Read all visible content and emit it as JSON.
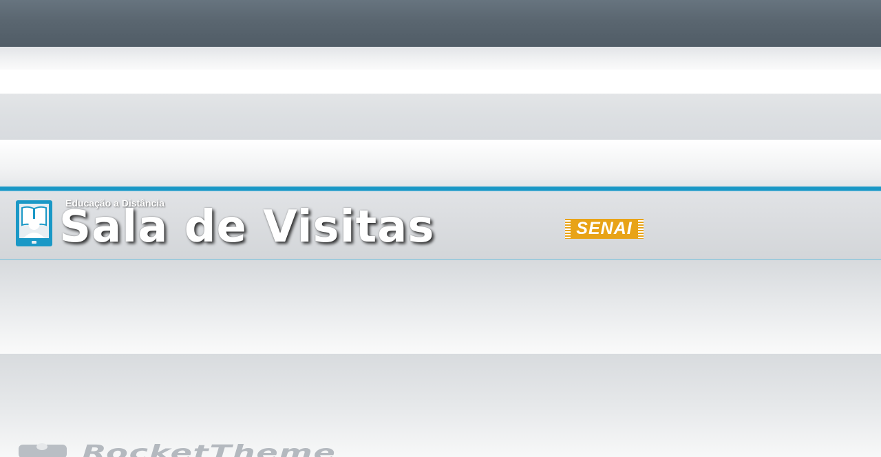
{
  "header": {
    "subtitle": "Educação a Distância",
    "title": "Sala de Visitas",
    "partner_logo_text": "SENAI"
  },
  "footer": {
    "brand_text": "RocketTheme"
  },
  "icons": {
    "site_logo": "tablet-reader-icon",
    "footer_logo": "rockettheme-logo-icon"
  },
  "colors": {
    "top_bar": "#5a6670",
    "accent_blue": "#1a98c6",
    "senai_orange": "#e8a317"
  }
}
